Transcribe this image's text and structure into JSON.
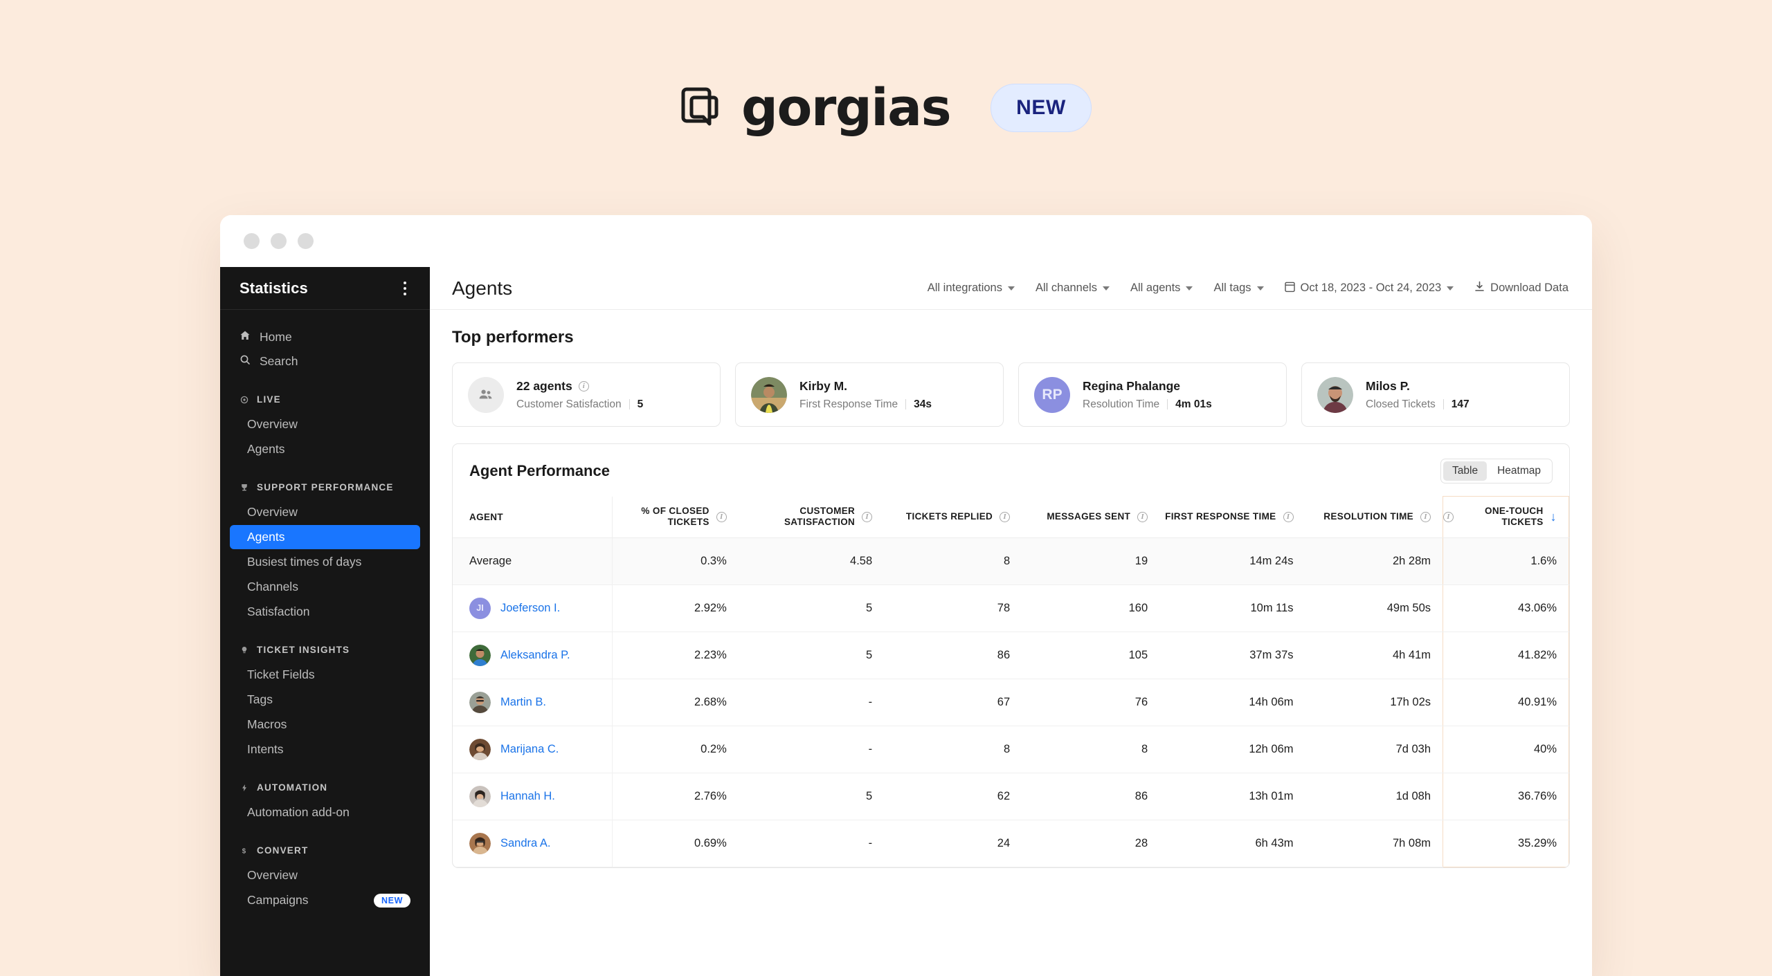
{
  "brand": {
    "wordmark": "gorgias",
    "badge": "NEW",
    "logo_icon": "gorgias-logo-icon"
  },
  "sidebar": {
    "title": "Statistics",
    "menu_icon": "kebab-menu-icon",
    "top_items": [
      {
        "label": "Home",
        "icon": "home-icon"
      },
      {
        "label": "Search",
        "icon": "search-icon"
      }
    ],
    "groups": [
      {
        "label": "LIVE",
        "icon": "live-dot-icon",
        "items": [
          {
            "label": "Overview",
            "active": false,
            "badge": ""
          },
          {
            "label": "Agents",
            "active": false,
            "badge": ""
          }
        ]
      },
      {
        "label": "SUPPORT PERFORMANCE",
        "icon": "trophy-icon",
        "items": [
          {
            "label": "Overview",
            "active": false,
            "badge": ""
          },
          {
            "label": "Agents",
            "active": true,
            "badge": ""
          },
          {
            "label": "Busiest times of days",
            "active": false,
            "badge": ""
          },
          {
            "label": "Channels",
            "active": false,
            "badge": ""
          },
          {
            "label": "Satisfaction",
            "active": false,
            "badge": ""
          }
        ]
      },
      {
        "label": "TICKET INSIGHTS",
        "icon": "lightbulb-icon",
        "items": [
          {
            "label": "Ticket Fields",
            "active": false,
            "badge": ""
          },
          {
            "label": "Tags",
            "active": false,
            "badge": ""
          },
          {
            "label": "Macros",
            "active": false,
            "badge": ""
          },
          {
            "label": "Intents",
            "active": false,
            "badge": ""
          }
        ]
      },
      {
        "label": "AUTOMATION",
        "icon": "bolt-icon",
        "items": [
          {
            "label": "Automation add-on",
            "active": false,
            "badge": ""
          }
        ]
      },
      {
        "label": "CONVERT",
        "icon": "dollar-icon",
        "items": [
          {
            "label": "Overview",
            "active": false,
            "badge": ""
          },
          {
            "label": "Campaigns",
            "active": false,
            "badge": "NEW"
          }
        ]
      }
    ]
  },
  "header": {
    "page_title": "Agents",
    "filters": [
      {
        "label": "All integrations",
        "icon": "chevron-down-icon"
      },
      {
        "label": "All channels",
        "icon": "chevron-down-icon"
      },
      {
        "label": "All agents",
        "icon": "chevron-down-icon"
      },
      {
        "label": "All tags",
        "icon": "chevron-down-icon"
      }
    ],
    "date_range": {
      "label": "Oct 18, 2023 - Oct 24, 2023",
      "icon": "calendar-icon"
    },
    "download": {
      "label": "Download Data",
      "icon": "download-icon"
    }
  },
  "top_performers": {
    "title": "Top performers",
    "cards": [
      {
        "name": "22 agents",
        "has_info": true,
        "metric": "Customer Satisfaction",
        "value": "5",
        "avatar_type": "group",
        "avatar_icon": "people-icon"
      },
      {
        "name": "Kirby M.",
        "has_info": false,
        "metric": "First Response Time",
        "value": "34s",
        "avatar_type": "photo",
        "avatar_colors": [
          "#7d8a62",
          "#caa86f",
          "#3f4a34"
        ]
      },
      {
        "name": "Regina Phalange",
        "has_info": false,
        "metric": "Resolution Time",
        "value": "4m 01s",
        "avatar_type": "initials",
        "initials": "RP"
      },
      {
        "name": "Milos P.",
        "has_info": false,
        "metric": "Closed Tickets",
        "value": "147",
        "avatar_type": "photo",
        "avatar_colors": [
          "#b9c4bf",
          "#6d4b3c",
          "#2b2b2b"
        ]
      }
    ]
  },
  "agent_performance": {
    "title": "Agent Performance",
    "view_toggle": {
      "options": [
        "Table",
        "Heatmap"
      ],
      "selected": "Table"
    },
    "columns": [
      {
        "label": "AGENT",
        "info": false,
        "sorted": false
      },
      {
        "label": "% OF CLOSED TICKETS",
        "info": true,
        "sorted": false
      },
      {
        "label": "CUSTOMER SATISFACTION",
        "info": true,
        "sorted": false
      },
      {
        "label": "TICKETS REPLIED",
        "info": true,
        "sorted": false
      },
      {
        "label": "MESSAGES SENT",
        "info": true,
        "sorted": false
      },
      {
        "label": "FIRST RESPONSE TIME",
        "info": true,
        "sorted": false
      },
      {
        "label": "RESOLUTION TIME",
        "info": true,
        "sorted": false
      },
      {
        "label": "ONE-TOUCH TICKETS",
        "info": true,
        "sorted": true,
        "sort_dir": "desc"
      }
    ],
    "average_row": {
      "label": "Average",
      "closed_pct": "0.3%",
      "csat": "4.58",
      "tickets_replied": "8",
      "messages_sent": "19",
      "first_response_time": "14m 24s",
      "resolution_time": "2h 28m",
      "one_touch": "1.6%"
    },
    "rows": [
      {
        "name": "Joeferson I.",
        "avatar_type": "initials",
        "initials": "JI",
        "closed_pct": "2.92%",
        "csat": "5",
        "tickets_replied": "78",
        "messages_sent": "160",
        "first_response_time": "10m 11s",
        "resolution_time": "49m 50s",
        "one_touch": "43.06%"
      },
      {
        "name": "Aleksandra P.",
        "avatar_type": "photo",
        "avatar_colors": [
          "#3f6b3a",
          "#2f7fd0",
          "#1d3a22"
        ],
        "closed_pct": "2.23%",
        "csat": "5",
        "tickets_replied": "86",
        "messages_sent": "105",
        "first_response_time": "37m 37s",
        "resolution_time": "4h 41m",
        "one_touch": "41.82%"
      },
      {
        "name": "Martin B.",
        "avatar_type": "photo",
        "avatar_colors": [
          "#9aa096",
          "#554a3d",
          "#34302a"
        ],
        "closed_pct": "2.68%",
        "csat": "-",
        "tickets_replied": "67",
        "messages_sent": "76",
        "first_response_time": "14h 06m",
        "resolution_time": "17h 02s",
        "one_touch": "40.91%"
      },
      {
        "name": "Marijana C.",
        "avatar_type": "photo",
        "avatar_colors": [
          "#6e4b33",
          "#d9cec4",
          "#3b2a1e"
        ],
        "closed_pct": "0.2%",
        "csat": "-",
        "tickets_replied": "8",
        "messages_sent": "8",
        "first_response_time": "12h 06m",
        "resolution_time": "7d 03h",
        "one_touch": "40%"
      },
      {
        "name": "Hannah H.",
        "avatar_type": "photo",
        "avatar_colors": [
          "#c9c2bd",
          "#2b2420",
          "#e2dcd6"
        ],
        "closed_pct": "2.76%",
        "csat": "5",
        "tickets_replied": "62",
        "messages_sent": "86",
        "first_response_time": "13h 01m",
        "resolution_time": "1d 08h",
        "one_touch": "36.76%"
      },
      {
        "name": "Sandra A.",
        "avatar_type": "photo",
        "avatar_colors": [
          "#a8764e",
          "#33241a",
          "#d9b68f"
        ],
        "closed_pct": "0.69%",
        "csat": "-",
        "tickets_replied": "24",
        "messages_sent": "28",
        "first_response_time": "6h 43m",
        "resolution_time": "7h 08m",
        "one_touch": "35.29%"
      }
    ]
  },
  "colors": {
    "page_background": "#fcebdd",
    "accent_blue": "#1976ff",
    "link_blue": "#1a73e8",
    "sidebar_bg": "#161616",
    "highlight_column_border": "#f6dcc4",
    "badge_bg": "#e3ecff",
    "badge_text": "#1a237e"
  }
}
